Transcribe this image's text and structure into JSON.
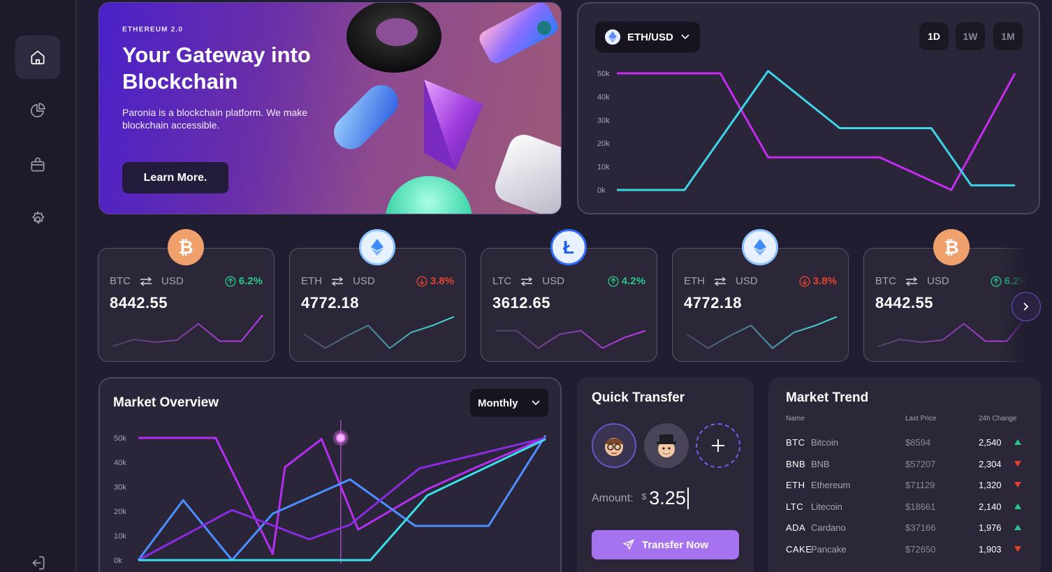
{
  "sidebar": {
    "items": [
      {
        "icon": "home-icon",
        "active": true
      },
      {
        "icon": "pie-chart-icon",
        "active": false
      },
      {
        "icon": "bag-icon",
        "active": false
      },
      {
        "icon": "gear-icon",
        "active": false
      },
      {
        "icon": "logout-icon",
        "active": false
      }
    ]
  },
  "hero": {
    "tag": "ETHEREUM 2.0",
    "title": "Your Gateway into Blockchain",
    "description": "Paronia is a blockchain platform. We make blockchain accessible.",
    "button_label": "Learn More."
  },
  "price_chart": {
    "pair_label": "ETH/USD",
    "timeframes": [
      "1D",
      "1W",
      "1M"
    ],
    "active_timeframe": "1D"
  },
  "tickers": [
    {
      "coin": "BTC",
      "quote": "USD",
      "change": "6.2%",
      "direction": "up",
      "price": "8442.55",
      "spark": [
        0.1,
        0.3,
        0.22,
        0.28,
        0.75,
        0.25,
        0.25,
        1.0
      ]
    },
    {
      "coin": "ETH",
      "quote": "USD",
      "change": "3.8%",
      "direction": "down",
      "price": "4772.18",
      "spark": [
        0.45,
        0.05,
        0.4,
        0.7,
        0.05,
        0.5,
        0.7,
        0.95
      ]
    },
    {
      "coin": "LTC",
      "quote": "USD",
      "change": "4.2%",
      "direction": "up",
      "price": "3612.65",
      "spark": [
        0.55,
        0.55,
        0.05,
        0.45,
        0.55,
        0.05,
        0.35,
        0.55
      ]
    },
    {
      "coin": "ETH",
      "quote": "USD",
      "change": "3.8%",
      "direction": "down",
      "price": "4772.18",
      "spark": [
        0.45,
        0.05,
        0.4,
        0.7,
        0.05,
        0.5,
        0.7,
        0.95
      ]
    },
    {
      "coin": "BTC",
      "quote": "USD",
      "change": "6.2%",
      "direction": "up",
      "price": "8442.55",
      "spark": [
        0.1,
        0.3,
        0.22,
        0.28,
        0.75,
        0.25,
        0.25,
        1.0
      ]
    }
  ],
  "market_overview": {
    "title": "Market Overview",
    "period_label": "Monthly"
  },
  "quick_transfer": {
    "title": "Quick Transfer",
    "amount_label": "Amount:",
    "currency": "$",
    "amount_value": "3.25",
    "button_label": "Transfer Now"
  },
  "market_trend": {
    "title": "Market Trend",
    "headers": {
      "name": "Name",
      "last_price": "Last Price",
      "change": "24h Change"
    },
    "rows": [
      {
        "symbol": "BTC",
        "name": "Bitcoin",
        "price": "$8594",
        "change": "2,540",
        "direction": "up"
      },
      {
        "symbol": "BNB",
        "name": "BNB",
        "price": "$57207",
        "change": "2,304",
        "direction": "down"
      },
      {
        "symbol": "ETH",
        "name": "Ethereum",
        "price": "$71129",
        "change": "1,320",
        "direction": "down"
      },
      {
        "symbol": "LTC",
        "name": "Litecoin",
        "price": "$18661",
        "change": "2,140",
        "direction": "up"
      },
      {
        "symbol": "ADA",
        "name": "Cardano",
        "price": "$37166",
        "change": "1,976",
        "direction": "up"
      },
      {
        "symbol": "CAKE",
        "name": "Pancake",
        "price": "$72650",
        "change": "1,903",
        "direction": "down"
      }
    ]
  },
  "chart_data": [
    {
      "type": "line",
      "ylim": [
        0,
        50000
      ],
      "yticks": [
        "0k",
        "10k",
        "20k",
        "30k",
        "40k",
        "50k"
      ],
      "series": [
        {
          "color": "#c62cf0",
          "x": [
            0,
            0.26,
            0.38,
            0.66,
            0.84,
            1.0
          ],
          "values": [
            50000,
            50000,
            14000,
            14000,
            0,
            50000
          ]
        },
        {
          "color": "#3fd4e8",
          "x": [
            0,
            0.17,
            0.38,
            0.56,
            0.79,
            0.89,
            1.0
          ],
          "values": [
            0,
            0,
            51000,
            26500,
            26500,
            2000,
            2000
          ]
        }
      ]
    },
    {
      "type": "line",
      "ylim": [
        0,
        50000
      ],
      "yticks": [
        "0k",
        "10k",
        "20k",
        "30k",
        "40k",
        "50k"
      ],
      "series": [
        {
          "color": "#b52ff0",
          "x": [
            0,
            0.19,
            0.33,
            0.36,
            0.45,
            0.54,
            0.71,
            0.83,
            1.0
          ],
          "values": [
            50000,
            50000,
            2500,
            38000,
            49500,
            12500,
            29000,
            38000,
            50000
          ]
        },
        {
          "color": "#4c8fff",
          "x": [
            0,
            0.11,
            0.23,
            0.33,
            0.52,
            0.68,
            0.86,
            1.0
          ],
          "values": [
            0,
            24500,
            0,
            19000,
            33000,
            14000,
            14000,
            51000
          ]
        },
        {
          "color": "#8a2be2",
          "x": [
            0,
            0.23,
            0.42,
            0.52,
            0.69,
            1.0
          ],
          "values": [
            0,
            20500,
            8500,
            14500,
            37500,
            50000
          ]
        },
        {
          "color": "#38e0e8",
          "x": [
            0,
            0.12,
            0.57,
            0.71,
            1.0
          ],
          "values": [
            0,
            0,
            0,
            26500,
            49500
          ]
        }
      ]
    }
  ]
}
